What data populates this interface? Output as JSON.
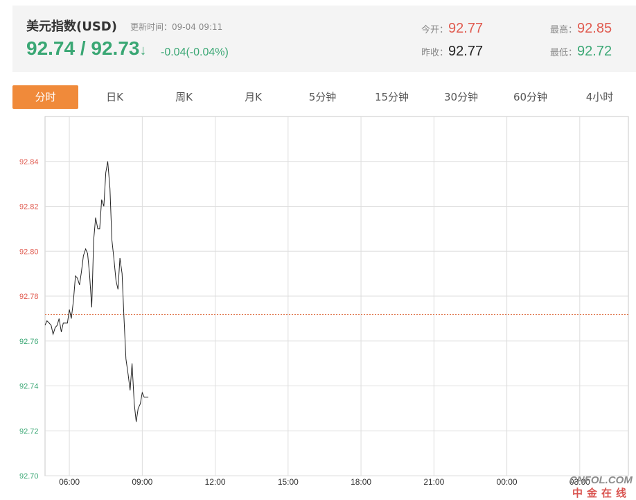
{
  "header": {
    "name": "美元指数(USD)",
    "update_label": "更新时间：",
    "update_time": "09-04 09:11",
    "price": "92.74 / 92.73",
    "arrow": "↓",
    "change": "-0.04(-0.04%)",
    "open_label": "今开：",
    "open_value": "92.77",
    "prev_close_label": "昨收：",
    "prev_close_value": "92.77",
    "high_label": "最高：",
    "high_value": "92.85",
    "low_label": "最低：",
    "low_value": "92.72"
  },
  "tabs": [
    "分时",
    "日K",
    "周K",
    "月K",
    "5分钟",
    "15分钟",
    "30分钟",
    "60分钟",
    "4小时"
  ],
  "active_tab": 0,
  "colors": {
    "up": "#e05a4f",
    "down": "#3aa774",
    "accent": "#f08a3a",
    "line": "#222222",
    "ref_line": "#e0784f"
  },
  "watermark": {
    "logo": "CNFOL.COM",
    "text": "中金在线"
  },
  "chart_data": {
    "type": "line",
    "x_ticks": [
      "06:00",
      "09:00",
      "12:00",
      "15:00",
      "18:00",
      "21:00",
      "00:00",
      "03:00"
    ],
    "y_ticks": [
      "92.84",
      "92.82",
      "92.80",
      "92.78",
      "92.76",
      "92.74",
      "92.72",
      "92.70"
    ],
    "ylim": [
      92.7,
      92.86
    ],
    "xlim_hours": [
      5.0,
      29.0
    ],
    "reference_value": 92.7718,
    "reference_style": "dashed",
    "grid": true,
    "series": [
      {
        "x": [
          5.0,
          5.08,
          5.17,
          5.25,
          5.33,
          5.42,
          5.5,
          5.58,
          5.67,
          5.75,
          5.83,
          5.92,
          6.0,
          6.08,
          6.17,
          6.25,
          6.33,
          6.42,
          6.5,
          6.58,
          6.67,
          6.75,
          6.83,
          6.92,
          7.0,
          7.08,
          7.17,
          7.25,
          7.33,
          7.42,
          7.5,
          7.58,
          7.67,
          7.75,
          7.83,
          7.92,
          8.0,
          8.08,
          8.17,
          8.25,
          8.33,
          8.42,
          8.5,
          8.58,
          8.67,
          8.75,
          8.83,
          8.92,
          9.0,
          9.08,
          9.17,
          9.25
        ],
        "values": [
          92.767,
          92.769,
          92.768,
          92.767,
          92.763,
          92.766,
          92.767,
          92.77,
          92.764,
          92.768,
          92.768,
          92.768,
          92.774,
          92.77,
          92.778,
          92.789,
          92.788,
          92.785,
          92.791,
          92.798,
          92.801,
          92.799,
          92.79,
          92.775,
          92.805,
          92.815,
          92.81,
          92.81,
          92.823,
          92.82,
          92.835,
          92.84,
          92.828,
          92.805,
          92.797,
          92.787,
          92.783,
          92.797,
          92.79,
          92.77,
          92.752,
          92.745,
          92.738,
          92.75,
          92.732,
          92.724,
          92.73,
          92.732,
          92.737,
          92.735,
          92.735,
          92.735
        ]
      }
    ]
  }
}
